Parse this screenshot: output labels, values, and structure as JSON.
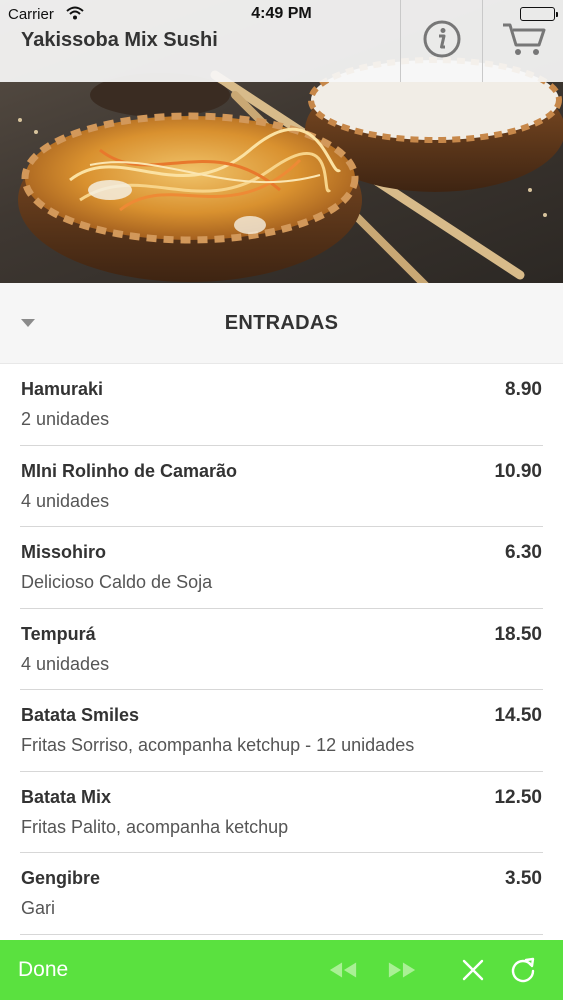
{
  "status_bar": {
    "carrier": "Carrier",
    "time": "4:49 PM"
  },
  "header": {
    "title": "Yakissoba Mix Sushi",
    "info_icon": "info-icon",
    "cart_icon": "cart-icon"
  },
  "section": {
    "title": "ENTRADAS"
  },
  "items": [
    {
      "name": "Hamuraki",
      "description": "2 unidades",
      "price": "8.90"
    },
    {
      "name": "MIni Rolinho de Camarão",
      "description": "4 unidades",
      "price": "10.90"
    },
    {
      "name": "Missohiro",
      "description": "Delicioso Caldo de Soja",
      "price": "6.30"
    },
    {
      "name": "Tempurá",
      "description": "4 unidades",
      "price": "18.50"
    },
    {
      "name": "Batata Smiles",
      "description": "Fritas Sorriso, acompanha ketchup - 12 unidades",
      "price": "14.50"
    },
    {
      "name": "Batata Mix",
      "description": "Fritas Palito, acompanha ketchup",
      "price": "12.50"
    },
    {
      "name": "Gengibre",
      "description": "Gari",
      "price": "3.50"
    }
  ],
  "toolbar": {
    "done_label": "Done",
    "icons": [
      "back-icon",
      "forward-icon",
      "close-icon",
      "refresh-icon"
    ],
    "bg_color": "#5ae13f"
  }
}
